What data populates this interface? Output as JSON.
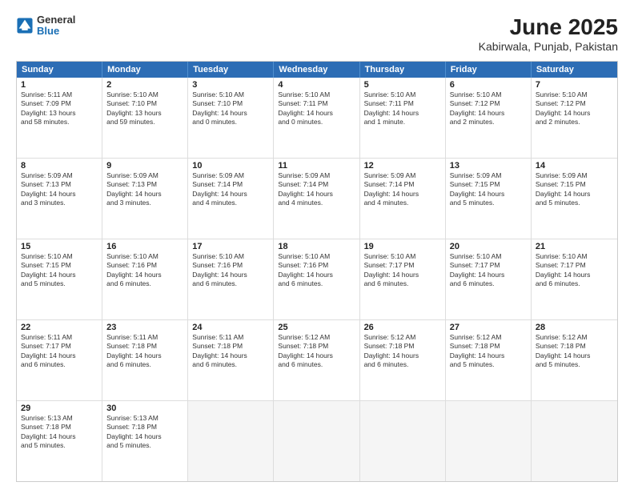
{
  "header": {
    "logo_general": "General",
    "logo_blue": "Blue",
    "title": "June 2025",
    "subtitle": "Kabirwala, Punjab, Pakistan"
  },
  "calendar": {
    "days": [
      "Sunday",
      "Monday",
      "Tuesday",
      "Wednesday",
      "Thursday",
      "Friday",
      "Saturday"
    ],
    "rows": [
      [
        {
          "day": "",
          "empty": true
        },
        {
          "day": "2",
          "line1": "Sunrise: 5:10 AM",
          "line2": "Sunset: 7:10 PM",
          "line3": "Daylight: 13 hours",
          "line4": "and 59 minutes."
        },
        {
          "day": "3",
          "line1": "Sunrise: 5:10 AM",
          "line2": "Sunset: 7:10 PM",
          "line3": "Daylight: 14 hours",
          "line4": "and 0 minutes."
        },
        {
          "day": "4",
          "line1": "Sunrise: 5:10 AM",
          "line2": "Sunset: 7:11 PM",
          "line3": "Daylight: 14 hours",
          "line4": "and 0 minutes."
        },
        {
          "day": "5",
          "line1": "Sunrise: 5:10 AM",
          "line2": "Sunset: 7:11 PM",
          "line3": "Daylight: 14 hours",
          "line4": "and 1 minute."
        },
        {
          "day": "6",
          "line1": "Sunrise: 5:10 AM",
          "line2": "Sunset: 7:12 PM",
          "line3": "Daylight: 14 hours",
          "line4": "and 2 minutes."
        },
        {
          "day": "7",
          "line1": "Sunrise: 5:10 AM",
          "line2": "Sunset: 7:12 PM",
          "line3": "Daylight: 14 hours",
          "line4": "and 2 minutes."
        }
      ],
      [
        {
          "day": "8",
          "line1": "Sunrise: 5:09 AM",
          "line2": "Sunset: 7:13 PM",
          "line3": "Daylight: 14 hours",
          "line4": "and 3 minutes."
        },
        {
          "day": "9",
          "line1": "Sunrise: 5:09 AM",
          "line2": "Sunset: 7:13 PM",
          "line3": "Daylight: 14 hours",
          "line4": "and 3 minutes."
        },
        {
          "day": "10",
          "line1": "Sunrise: 5:09 AM",
          "line2": "Sunset: 7:14 PM",
          "line3": "Daylight: 14 hours",
          "line4": "and 4 minutes."
        },
        {
          "day": "11",
          "line1": "Sunrise: 5:09 AM",
          "line2": "Sunset: 7:14 PM",
          "line3": "Daylight: 14 hours",
          "line4": "and 4 minutes."
        },
        {
          "day": "12",
          "line1": "Sunrise: 5:09 AM",
          "line2": "Sunset: 7:14 PM",
          "line3": "Daylight: 14 hours",
          "line4": "and 4 minutes."
        },
        {
          "day": "13",
          "line1": "Sunrise: 5:09 AM",
          "line2": "Sunset: 7:15 PM",
          "line3": "Daylight: 14 hours",
          "line4": "and 5 minutes."
        },
        {
          "day": "14",
          "line1": "Sunrise: 5:09 AM",
          "line2": "Sunset: 7:15 PM",
          "line3": "Daylight: 14 hours",
          "line4": "and 5 minutes."
        }
      ],
      [
        {
          "day": "15",
          "line1": "Sunrise: 5:10 AM",
          "line2": "Sunset: 7:15 PM",
          "line3": "Daylight: 14 hours",
          "line4": "and 5 minutes."
        },
        {
          "day": "16",
          "line1": "Sunrise: 5:10 AM",
          "line2": "Sunset: 7:16 PM",
          "line3": "Daylight: 14 hours",
          "line4": "and 6 minutes."
        },
        {
          "day": "17",
          "line1": "Sunrise: 5:10 AM",
          "line2": "Sunset: 7:16 PM",
          "line3": "Daylight: 14 hours",
          "line4": "and 6 minutes."
        },
        {
          "day": "18",
          "line1": "Sunrise: 5:10 AM",
          "line2": "Sunset: 7:16 PM",
          "line3": "Daylight: 14 hours",
          "line4": "and 6 minutes."
        },
        {
          "day": "19",
          "line1": "Sunrise: 5:10 AM",
          "line2": "Sunset: 7:17 PM",
          "line3": "Daylight: 14 hours",
          "line4": "and 6 minutes."
        },
        {
          "day": "20",
          "line1": "Sunrise: 5:10 AM",
          "line2": "Sunset: 7:17 PM",
          "line3": "Daylight: 14 hours",
          "line4": "and 6 minutes."
        },
        {
          "day": "21",
          "line1": "Sunrise: 5:10 AM",
          "line2": "Sunset: 7:17 PM",
          "line3": "Daylight: 14 hours",
          "line4": "and 6 minutes."
        }
      ],
      [
        {
          "day": "22",
          "line1": "Sunrise: 5:11 AM",
          "line2": "Sunset: 7:17 PM",
          "line3": "Daylight: 14 hours",
          "line4": "and 6 minutes."
        },
        {
          "day": "23",
          "line1": "Sunrise: 5:11 AM",
          "line2": "Sunset: 7:18 PM",
          "line3": "Daylight: 14 hours",
          "line4": "and 6 minutes."
        },
        {
          "day": "24",
          "line1": "Sunrise: 5:11 AM",
          "line2": "Sunset: 7:18 PM",
          "line3": "Daylight: 14 hours",
          "line4": "and 6 minutes."
        },
        {
          "day": "25",
          "line1": "Sunrise: 5:12 AM",
          "line2": "Sunset: 7:18 PM",
          "line3": "Daylight: 14 hours",
          "line4": "and 6 minutes."
        },
        {
          "day": "26",
          "line1": "Sunrise: 5:12 AM",
          "line2": "Sunset: 7:18 PM",
          "line3": "Daylight: 14 hours",
          "line4": "and 6 minutes."
        },
        {
          "day": "27",
          "line1": "Sunrise: 5:12 AM",
          "line2": "Sunset: 7:18 PM",
          "line3": "Daylight: 14 hours",
          "line4": "and 5 minutes."
        },
        {
          "day": "28",
          "line1": "Sunrise: 5:12 AM",
          "line2": "Sunset: 7:18 PM",
          "line3": "Daylight: 14 hours",
          "line4": "and 5 minutes."
        }
      ],
      [
        {
          "day": "29",
          "line1": "Sunrise: 5:13 AM",
          "line2": "Sunset: 7:18 PM",
          "line3": "Daylight: 14 hours",
          "line4": "and 5 minutes."
        },
        {
          "day": "30",
          "line1": "Sunrise: 5:13 AM",
          "line2": "Sunset: 7:18 PM",
          "line3": "Daylight: 14 hours",
          "line4": "and 5 minutes."
        },
        {
          "day": "",
          "empty": true
        },
        {
          "day": "",
          "empty": true
        },
        {
          "day": "",
          "empty": true
        },
        {
          "day": "",
          "empty": true
        },
        {
          "day": "",
          "empty": true
        }
      ]
    ],
    "row1_day1": {
      "day": "1",
      "line1": "Sunrise: 5:11 AM",
      "line2": "Sunset: 7:09 PM",
      "line3": "Daylight: 13 hours",
      "line4": "and 58 minutes."
    }
  }
}
